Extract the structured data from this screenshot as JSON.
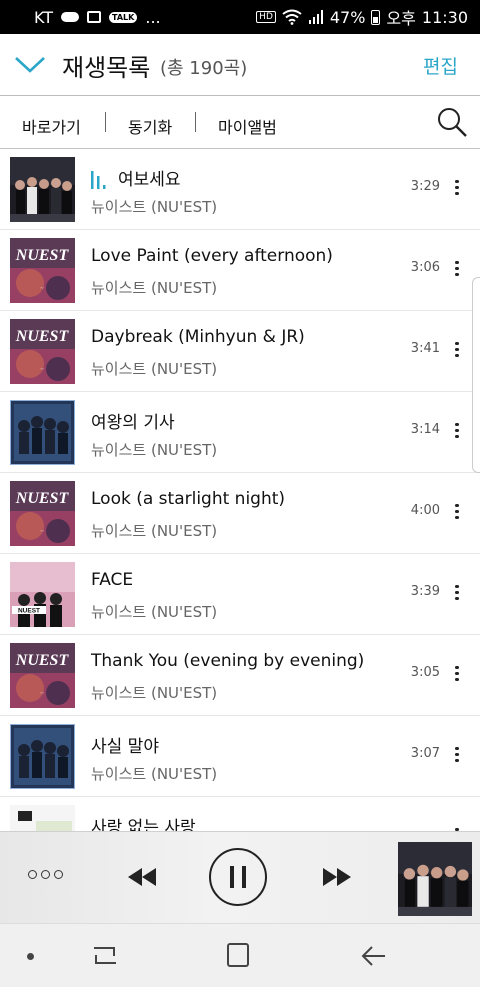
{
  "status_bar": {
    "carrier": "KT",
    "more": "...",
    "talk_badge": "TALK",
    "hd_badge": "HD",
    "battery": "47%",
    "ampm": "오후",
    "time": "11:30"
  },
  "header": {
    "title": "재생목록",
    "count": "(총 190곡)",
    "edit_label": "편집",
    "accent_color": "#2aa6c9"
  },
  "toolbar": {
    "goto_label": "바로가기",
    "sync_label": "동기화",
    "myalbum_label": "마이앨범"
  },
  "songs": [
    {
      "title": "여보세요",
      "artist": "뉴이스트 (NU'EST)",
      "duration": "3:29",
      "playing": true,
      "art": "night"
    },
    {
      "title": "Love Paint (every afternoon)",
      "artist": "뉴이스트 (NU'EST)",
      "duration": "3:06",
      "art": "canvas"
    },
    {
      "title": "Daybreak (Minhyun & JR)",
      "artist": "뉴이스트 (NU'EST)",
      "duration": "3:41",
      "art": "canvas"
    },
    {
      "title": "여왕의 기사",
      "artist": "뉴이스트 (NU'EST)",
      "duration": "3:14",
      "art": "queen"
    },
    {
      "title": "Look (a starlight night)",
      "artist": "뉴이스트 (NU'EST)",
      "duration": "4:00",
      "art": "canvas"
    },
    {
      "title": "FACE",
      "artist": "뉴이스트 (NU'EST)",
      "duration": "3:39",
      "art": "face"
    },
    {
      "title": "Thank You (evening by evening)",
      "artist": "뉴이스트 (NU'EST)",
      "duration": "3:05",
      "art": "canvas"
    },
    {
      "title": "사실 말야",
      "artist": "뉴이스트 (NU'EST)",
      "duration": "3:07",
      "art": "queen"
    },
    {
      "title": "사랑 없는 사랑",
      "artist": "",
      "duration": "",
      "art": "white"
    }
  ],
  "album_logo_text": "NU'EST",
  "player": {
    "state": "playing",
    "now_playing_art": "night"
  }
}
